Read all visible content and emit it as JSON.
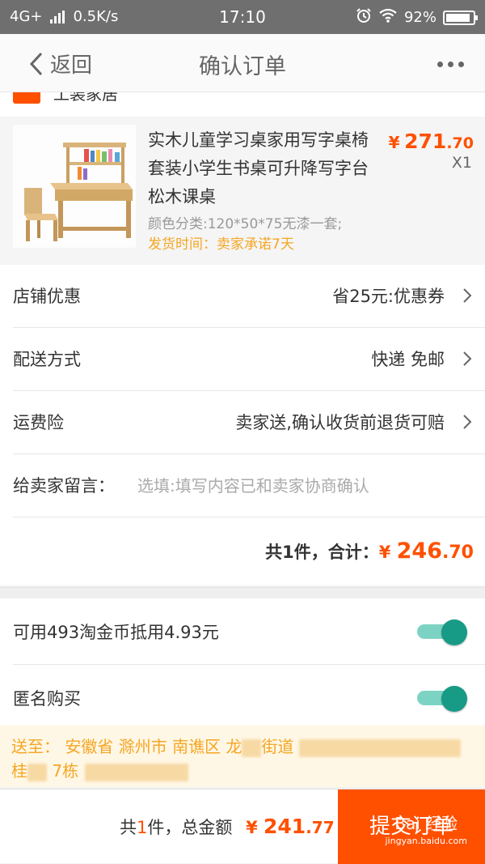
{
  "status_bar": {
    "network": "4G+",
    "speed": "0.5K/s",
    "time": "17:10",
    "battery": "92%",
    "battery_level": 0.92
  },
  "nav": {
    "back_label": "返回",
    "title": "确认订单"
  },
  "shop": {
    "name": "工装家居"
  },
  "product": {
    "title": "实木儿童学习桌家用写字桌椅套装小学生书桌可升降写字台松木课桌",
    "sku": "颜色分类:120*50*75无漆一套;",
    "shipping_time": "发货时间：卖家承诺7天",
    "price_currency": "¥",
    "price_main": "271",
    "price_decimal": ".70",
    "quantity": "X1"
  },
  "rows": {
    "store_discount_label": "店铺优惠",
    "store_discount_value": "省25元:优惠券",
    "delivery_label": "配送方式",
    "delivery_value": "快递 免邮",
    "insurance_label": "运费险",
    "insurance_value": "卖家送,确认收货前退货可赔",
    "message_label": "给卖家留言：",
    "message_placeholder": "选填:填写内容已和卖家协商确认"
  },
  "subtotal": {
    "prefix": "共1件，合计：",
    "currency": "¥",
    "main": "246",
    "decimal": ".70"
  },
  "options": {
    "coins_label": "可用493淘金币抵用4.93元",
    "coins_on": true,
    "anonymous_label": "匿名购买",
    "anonymous_on": true
  },
  "address": {
    "line1_visible": "送至： 安徽省 滁州市 南谯区 龙",
    "line1_after": "街道",
    "line2_visible": "桂",
    "line2_after": "7栋"
  },
  "footer": {
    "count_prefix": "共",
    "count": "1",
    "count_suffix": "件，总金额",
    "currency": "¥",
    "main": "241",
    "decimal": ".77",
    "submit_label": "提交订单",
    "watermark": "Bai 经验",
    "watermark_url": "jingyan.baidu.com"
  }
}
